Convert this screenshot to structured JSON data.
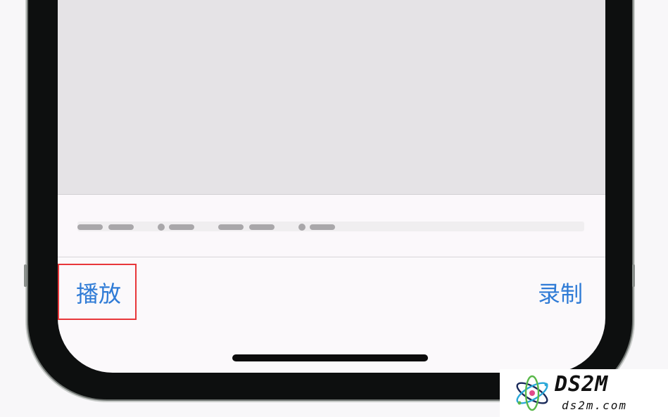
{
  "toolbar": {
    "play_label": "播放",
    "record_label": "录制"
  },
  "watermark": {
    "brand": "DS2M",
    "domain": "ds2m.com"
  },
  "colors": {
    "accent": "#2f7bd6",
    "highlight": "#e8373a",
    "frame": "#0d0f0f"
  }
}
